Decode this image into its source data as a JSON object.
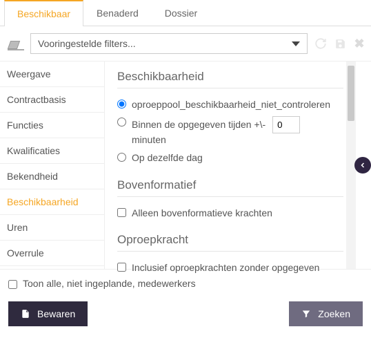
{
  "tabs": {
    "items": [
      {
        "label": "Beschikbaar"
      },
      {
        "label": "Benaderd"
      },
      {
        "label": "Dossier"
      }
    ]
  },
  "filterbar": {
    "preset_label": "Vooringestelde filters..."
  },
  "sidebar": {
    "items": [
      {
        "label": "Weergave"
      },
      {
        "label": "Contractbasis"
      },
      {
        "label": "Functies"
      },
      {
        "label": "Kwalificaties"
      },
      {
        "label": "Bekendheid"
      },
      {
        "label": "Beschikbaarheid"
      },
      {
        "label": "Uren"
      },
      {
        "label": "Overrule"
      }
    ]
  },
  "content": {
    "section1_title": "Beschikbaarheid",
    "radio_dont_check": "oproeppool_beschikbaarheid_niet_controleren",
    "radio_within_prefix": "Binnen de opgegeven tijden +\\-",
    "radio_within_value": "0",
    "radio_within_suffix": "minuten",
    "radio_same_day": "Op dezelfde dag",
    "section2_title": "Bovenformatief",
    "check_supernumerary": "Alleen bovenformatieve krachten",
    "section3_title": "Oproepkracht",
    "check_oncall": "Inclusief oproepkrachten zonder opgegeven"
  },
  "footer": {
    "check_showall": "Toon alle, niet ingeplande, medewerkers",
    "save_label": "Bewaren",
    "search_label": "Zoeken"
  }
}
